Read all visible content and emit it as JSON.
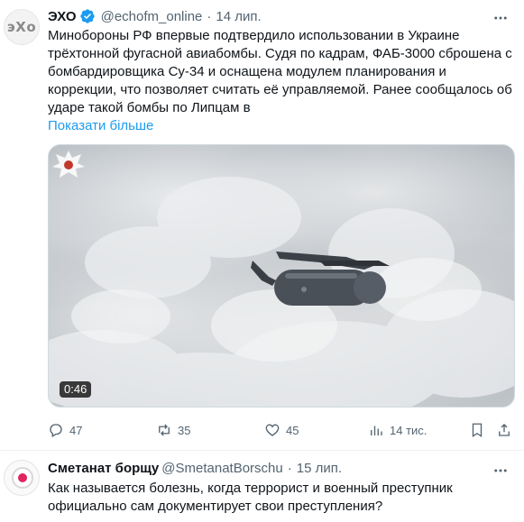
{
  "tweet1": {
    "avatar_text": "эХо",
    "name": "ЭХО",
    "handle": "@echofm_online",
    "separator": "·",
    "date": "14 лип.",
    "lines": [
      "Минобороны РФ впервые подтвердило использовании в Украине",
      "трёхтонной фугасной авиабомбы. Судя по кадрам, ФАБ-3000 сброшена с",
      "бомбардировщика Су-34 и оснащена модулем планирования и",
      "коррекции, что позволяет считать её управляемой. Ранее сообщалось об",
      "ударе такой бомбы по Липцам в"
    ],
    "show_more": "Показати більше",
    "video_duration": "0:46",
    "replies": "47",
    "reposts": "35",
    "likes": "45",
    "views": "14 тис."
  },
  "tweet2": {
    "name": "Сметанат борщу",
    "handle": "@SmetanatBorschu",
    "separator": "·",
    "date": "15 лип.",
    "lines": [
      "Как называется болезнь, когда террорист и военный преступник",
      "официально сам документирует свои преступления?"
    ]
  },
  "colors": {
    "accent": "#1d9bf0",
    "muted": "#536471",
    "text": "#0f1419",
    "verified": "#1d9bf0"
  },
  "icons": {
    "more": "more-horizontal-icon",
    "verified": "verified-badge-icon",
    "reply": "reply-icon",
    "repost": "repost-icon",
    "like": "heart-icon",
    "views": "views-chart-icon",
    "bookmark": "bookmark-icon",
    "share": "share-icon"
  }
}
